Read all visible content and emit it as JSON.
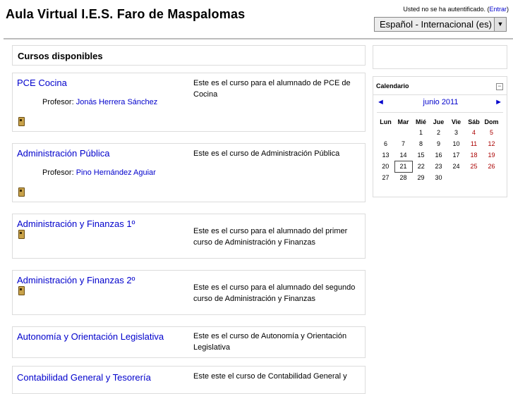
{
  "header": {
    "site_title": "Aula Virtual I.E.S. Faro de Maspalomas",
    "login_text": "Usted no se ha autentificado. (",
    "login_link": "Entrar",
    "login_close": ")",
    "language": "Español - Internacional (es)",
    "language_arrow": "▼"
  },
  "courses": {
    "heading": "Cursos disponibles",
    "items": [
      {
        "name": "PCE Cocina",
        "teacher_label": "Profesor:",
        "teacher": "Jonás Herrera Sánchez",
        "summary": "Este es el curso para el alumnado de PCE de Cocina"
      },
      {
        "name": "Administración Pública",
        "teacher_label": "Profesor:",
        "teacher": "Pino Hernández Aguiar",
        "summary": "Este es el curso de Administración Pública"
      },
      {
        "name": "Administración y Finanzas 1º",
        "summary": "Este es el curso para el alumnado del primer curso de Administración y Finanzas"
      },
      {
        "name": "Administración y Finanzas 2º",
        "summary": "Este es el curso para el alumnado del segundo curso de Administración y Finanzas"
      },
      {
        "name": "Autonomía y Orientación Legislativa",
        "summary": "Este es el curso de Autonomía y Orientación Legislativa"
      },
      {
        "name": "Contabilidad General y Tesorería",
        "summary": "Este este el curso de Contabilidad General y"
      }
    ]
  },
  "calendar": {
    "title": "Calendario",
    "hide_symbol": "−",
    "prev": "◄",
    "next": "►",
    "month": "junio 2011",
    "weekdays": [
      "Lun",
      "Mar",
      "Mié",
      "Jue",
      "Vie",
      "Sáb",
      "Dom"
    ],
    "weeks": [
      [
        "",
        "",
        "1",
        "2",
        "3",
        "4",
        "5"
      ],
      [
        "6",
        "7",
        "8",
        "9",
        "10",
        "11",
        "12"
      ],
      [
        "13",
        "14",
        "15",
        "16",
        "17",
        "18",
        "19"
      ],
      [
        "20",
        "21",
        "22",
        "23",
        "24",
        "25",
        "26"
      ],
      [
        "27",
        "28",
        "29",
        "30",
        "",
        "",
        ""
      ]
    ],
    "today": "21",
    "weekend_color": "#aa0000"
  }
}
